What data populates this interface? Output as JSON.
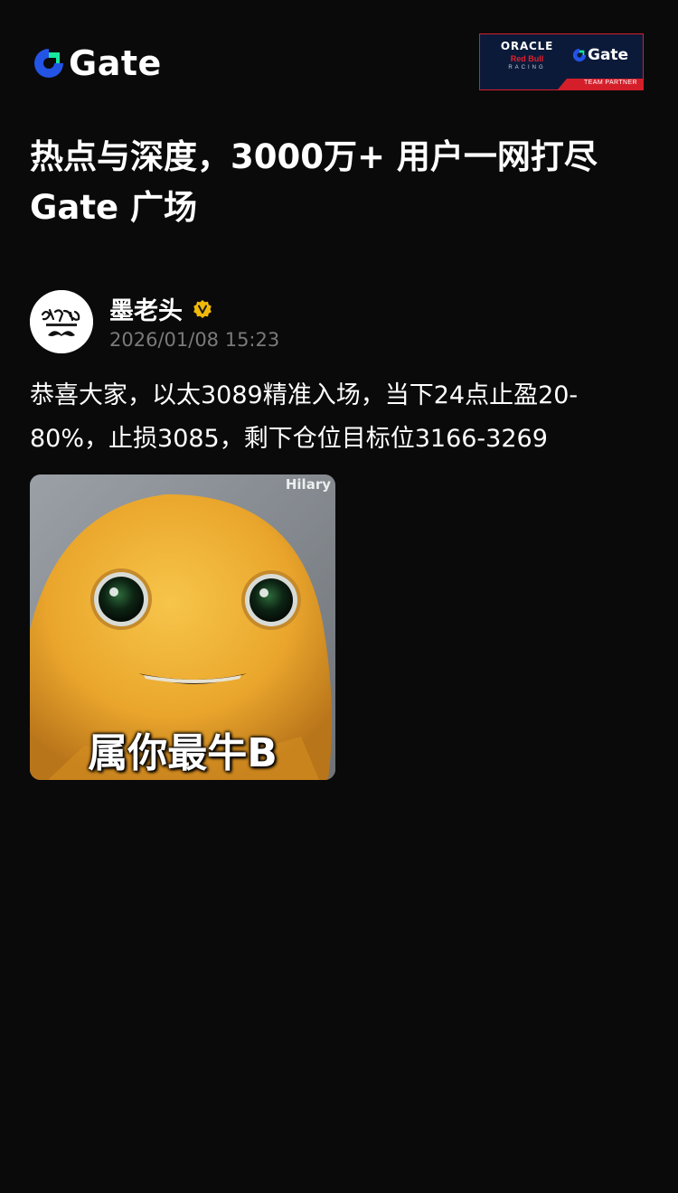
{
  "header": {
    "brand": "Gate",
    "partner": {
      "line1": "ORACLE",
      "line2": "Red Bull",
      "line3": "RACING",
      "gate_text": "Gate",
      "strip": "TEAM PARTNER"
    }
  },
  "headline": "热点与深度，3000万+ 用户一网打尽 Gate 广场",
  "post": {
    "author": "墨老头",
    "time": "2026/01/08 15:23",
    "content": "恭喜大家，以太3089精准入场，当下24点止盈20-80%，止损3085，剩下仓位目标位3166-3269",
    "image": {
      "watermark": "Hilary",
      "caption": "属你最牛B"
    }
  },
  "colors": {
    "background": "#0a0a0a",
    "brand_blue": "#2354e6",
    "brand_green": "#17e6a1",
    "verified_gold": "#f0b90b",
    "muted_text": "#7a7a7a",
    "partner_navy": "#0c1a3a",
    "partner_red": "#d41f2b"
  },
  "icons": {
    "brand_logo": "gate-logo-icon",
    "verified": "verified-badge-icon",
    "avatar": "calligraphy-mustache-avatar"
  }
}
